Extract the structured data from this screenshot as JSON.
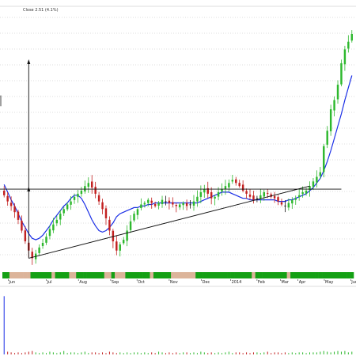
{
  "chart_data": {
    "type": "candlestick",
    "header": "Close 2.51 (4.1%)",
    "x_tick_labels": [
      "Jun",
      "Jul",
      "Aug",
      "Sep",
      "Oct",
      "Nov",
      "Dec",
      "2014",
      "Feb",
      "Mar",
      "Apr",
      "May",
      "Jun"
    ],
    "title": "",
    "xlabel": "",
    "ylabel": "",
    "grid": true,
    "legend": "none",
    "close_series": [
      1.4,
      1.36,
      1.33,
      1.29,
      1.24,
      1.17,
      1.1,
      1.04,
      0.99,
      1.02,
      1.06,
      1.09,
      1.13,
      1.18,
      1.21,
      1.24,
      1.28,
      1.31,
      1.34,
      1.36,
      1.39,
      1.41,
      1.43,
      1.46,
      1.48,
      1.45,
      1.41,
      1.36,
      1.31,
      1.25,
      1.17,
      1.1,
      1.04,
      1.08,
      1.11,
      1.17,
      1.23,
      1.28,
      1.31,
      1.34,
      1.35,
      1.37,
      1.35,
      1.33,
      1.35,
      1.37,
      1.36,
      1.35,
      1.34,
      1.33,
      1.34,
      1.35,
      1.33,
      1.34,
      1.36,
      1.39,
      1.42,
      1.44,
      1.41,
      1.38,
      1.39,
      1.42,
      1.44,
      1.46,
      1.48,
      1.5,
      1.48,
      1.46,
      1.43,
      1.41,
      1.39,
      1.37,
      1.38,
      1.4,
      1.42,
      1.41,
      1.39,
      1.38,
      1.36,
      1.34,
      1.33,
      1.35,
      1.37,
      1.38,
      1.4,
      1.42,
      1.43,
      1.46,
      1.49,
      1.52,
      1.55,
      1.72,
      1.82,
      1.96,
      2.02,
      2.12,
      2.26,
      2.35,
      2.4,
      2.45
    ],
    "moving_average_series": [
      1.47,
      1.42,
      1.37,
      1.33,
      1.28,
      1.23,
      1.19,
      1.15,
      1.12,
      1.11,
      1.12,
      1.14,
      1.17,
      1.2,
      1.24,
      1.27,
      1.3,
      1.33,
      1.35,
      1.38,
      1.4,
      1.4,
      1.38,
      1.34,
      1.29,
      1.24,
      1.2,
      1.17,
      1.16,
      1.17,
      1.19,
      1.22,
      1.26,
      1.28,
      1.29,
      1.3,
      1.31,
      1.32,
      1.32,
      1.33,
      1.33,
      1.34,
      1.34,
      1.35,
      1.35,
      1.35,
      1.35,
      1.35,
      1.35,
      1.35,
      1.35,
      1.35,
      1.35,
      1.35,
      1.35,
      1.35,
      1.36,
      1.37,
      1.38,
      1.39,
      1.4,
      1.41,
      1.42,
      1.42,
      1.42,
      1.41,
      1.4,
      1.39,
      1.38,
      1.38,
      1.37,
      1.37,
      1.37,
      1.37,
      1.37,
      1.37,
      1.37,
      1.37,
      1.36,
      1.36,
      1.36,
      1.37,
      1.37,
      1.38,
      1.39,
      1.4,
      1.41,
      1.43,
      1.45,
      1.48,
      1.51,
      1.56,
      1.62,
      1.69,
      1.77,
      1.85,
      1.93,
      2.02,
      2.1,
      2.18
    ],
    "resistance_level": 1.44,
    "support_trendline": {
      "start": 0.99,
      "end": 1.46
    },
    "measured_move": {
      "from": 1.44,
      "to": 2.28
    },
    "volume": [
      85,
      4,
      3,
      2,
      3,
      2,
      3,
      4,
      5,
      3,
      2,
      3,
      2,
      4,
      3,
      2,
      3,
      5,
      2,
      3,
      3,
      2,
      3,
      4,
      2,
      3,
      3,
      2,
      3,
      2,
      4,
      3,
      2,
      3,
      2,
      3,
      2,
      3,
      3,
      2,
      3,
      2,
      3,
      2,
      4,
      3,
      2,
      3,
      2,
      3,
      2,
      3,
      3,
      2,
      3,
      2,
      4,
      3,
      2,
      3,
      2,
      3,
      2,
      3,
      4,
      2,
      3,
      3,
      2,
      3,
      2,
      3,
      3,
      2,
      3,
      4,
      2,
      3,
      3,
      2,
      3,
      2,
      3,
      2,
      3,
      3,
      2,
      3,
      3,
      3,
      4,
      5,
      4,
      3,
      4,
      5,
      4,
      5,
      3,
      4
    ],
    "colors": {
      "up_candle": "#2db82d",
      "down_candle": "#c22020",
      "neutral_candle": "#111111",
      "moving_average": "#1a2ee6",
      "volume": "#1a2ee6",
      "grid": "#bbbbbb",
      "band_green": "#14a014",
      "band_tan": "#dcb49a"
    },
    "signal_band": [
      "green",
      "green",
      "tan",
      "tan",
      "tan",
      "tan",
      "tan",
      "tan",
      "green",
      "green",
      "green",
      "green",
      "green",
      "green",
      "tan",
      "green",
      "green",
      "green",
      "green",
      "tan",
      "tan",
      "green",
      "green",
      "green",
      "green",
      "green",
      "green",
      "green",
      "green",
      "tan",
      "tan",
      "green",
      "tan",
      "tan",
      "tan",
      "green",
      "green",
      "green",
      "green",
      "green",
      "green",
      "green",
      "tan",
      "green",
      "green",
      "green",
      "green",
      "green",
      "tan",
      "tan",
      "tan",
      "tan",
      "tan",
      "tan",
      "tan",
      "green",
      "green",
      "green",
      "green",
      "green",
      "green",
      "green",
      "green",
      "green",
      "green",
      "green",
      "green",
      "green",
      "green",
      "green",
      "green",
      "tan",
      "green",
      "green",
      "green",
      "green",
      "green",
      "green",
      "green",
      "green",
      "green",
      "tan",
      "green",
      "green",
      "green",
      "green",
      "green",
      "green",
      "green",
      "green",
      "green",
      "green",
      "green",
      "green",
      "green",
      "green",
      "green",
      "green",
      "green",
      "green"
    ]
  }
}
